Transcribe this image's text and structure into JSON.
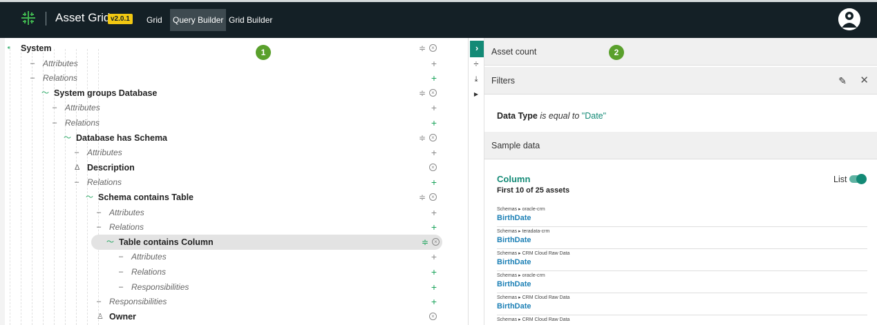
{
  "header": {
    "title": "Asset Grid",
    "version": "v2.0.1",
    "nav": [
      {
        "label": "Grid",
        "active": false
      },
      {
        "label": "Query Builder",
        "active": true
      },
      {
        "label": "Grid Builder",
        "active": false
      }
    ]
  },
  "badges": [
    "1",
    "2"
  ],
  "tree": [
    {
      "label": "System",
      "style": "b",
      "icon": "root-icon",
      "actions": "filter-remove"
    },
    {
      "label": "Attributes",
      "style": "i",
      "actions": "plus"
    },
    {
      "label": "Relations",
      "style": "i",
      "actions": "plus-green"
    },
    {
      "label": "System groups Database",
      "style": "b",
      "icon": "relation-icon",
      "actions": "filter-remove"
    },
    {
      "label": "Attributes",
      "style": "i",
      "actions": "plus"
    },
    {
      "label": "Relations",
      "style": "i",
      "actions": "plus-green"
    },
    {
      "label": "Database has Schema",
      "style": "b",
      "icon": "relation-icon",
      "actions": "filter-remove"
    },
    {
      "label": "Attributes",
      "style": "i",
      "actions": "plus"
    },
    {
      "label": "Description",
      "style": "b",
      "icon": "attribute-icon",
      "actions": "remove"
    },
    {
      "label": "Relations",
      "style": "i",
      "actions": "plus-green"
    },
    {
      "label": "Schema contains Table",
      "style": "b",
      "icon": "relation-icon",
      "actions": "filter-remove"
    },
    {
      "label": "Attributes",
      "style": "i",
      "actions": "plus"
    },
    {
      "label": "Relations",
      "style": "i",
      "actions": "plus-green"
    },
    {
      "label": "Table contains Column",
      "style": "b",
      "icon": "relation-icon",
      "actions": "filter-remove",
      "selected": true
    },
    {
      "label": "Attributes",
      "style": "i",
      "actions": "plus"
    },
    {
      "label": "Relations",
      "style": "i",
      "actions": "plus-green"
    },
    {
      "label": "Responsibilities",
      "style": "i",
      "actions": "plus-green"
    },
    {
      "label": "Responsibilities",
      "style": "i",
      "actions": "plus-green"
    },
    {
      "label": "Owner",
      "style": "b",
      "icon": "responsibility-icon",
      "actions": "remove"
    }
  ],
  "right": {
    "asset_count": "Asset count",
    "filters": "Filters",
    "filter": {
      "field": "Data Type",
      "operator": "is equal to",
      "value": "\"Date\""
    },
    "sample_data": "Sample data",
    "asset_type": "Column",
    "summary": "First 10 of 25 assets",
    "view_label": "List",
    "samples": [
      {
        "community": "Schemas",
        "domain": "oracle-crm",
        "name": "BirthDate"
      },
      {
        "community": "Schemas",
        "domain": "teradata-crm",
        "name": "BirthDate"
      },
      {
        "community": "Schemas",
        "domain": "CRM Cloud Raw Data",
        "name": "BirthDate"
      },
      {
        "community": "Schemas",
        "domain": "oracle-crm",
        "name": "BirthDate"
      },
      {
        "community": "Schemas",
        "domain": "CRM Cloud Raw Data",
        "name": "BirthDate"
      },
      {
        "community": "Schemas",
        "domain": "CRM Cloud Raw Data",
        "name": ""
      }
    ]
  },
  "colors": {
    "topbar": "#142026",
    "accent": "#138a76",
    "badge": "#5aa02c",
    "link": "#1b7fb5",
    "version_bg": "#f2c812"
  }
}
